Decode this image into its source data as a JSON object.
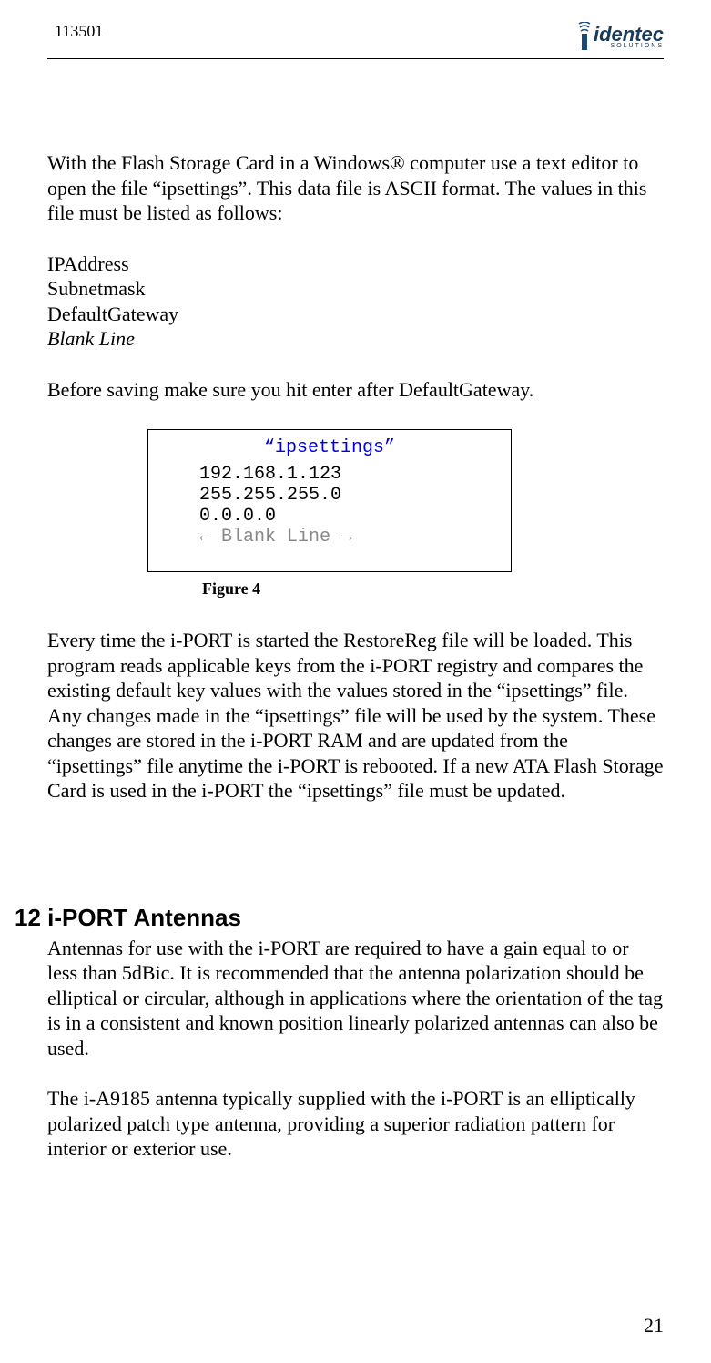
{
  "header": {
    "doc_id": "113501",
    "logo_text": "identec",
    "logo_sub": "SOLUTIONS"
  },
  "body": {
    "intro": "With the Flash Storage Card in a Windows® computer use a text editor to open the file “ipsettings”. This data file is ASCII format. The values in this file must be listed as follows:",
    "list": {
      "l1": "IPAddress",
      "l2": "Subnetmask",
      "l3": "DefaultGateway",
      "l4": "Blank Line"
    },
    "before_save": "Before saving make sure you hit enter after DefaultGateway.",
    "figure": {
      "title": "“ipsettings”",
      "line1": "192.168.1.123",
      "line2": "255.255.255.0",
      "line3": "0.0.0.0",
      "line4": "← Blank Line →",
      "caption": "Figure 4"
    },
    "after_fig": "Every time the i-PORT is started the RestoreReg file will be loaded. This program reads applicable keys from the i-PORT registry and compares the existing default key values with the values stored in the “ipsettings” file. Any changes made in the “ipsettings” file will be used by the system. These changes are stored in the i-PORT RAM and are updated from the “ipsettings” file anytime the i-PORT is rebooted. If a new ATA Flash Storage Card is used in the i-PORT the “ipsettings” file must be updated.",
    "section": {
      "heading": "12 i-PORT Antennas",
      "p1": "Antennas for use with the i-PORT are required to have a gain equal to or less than 5dBic. It is recommended that the antenna polarization should be elliptical or circular, although in applications where the orientation of the tag is in a consistent and known position linearly polarized antennas can also be used.",
      "p2": "The i-A9185 antenna typically supplied with the i-PORT is an elliptically polarized patch type antenna, providing a superior radiation pattern for interior or exterior use."
    }
  },
  "page_num": "21"
}
